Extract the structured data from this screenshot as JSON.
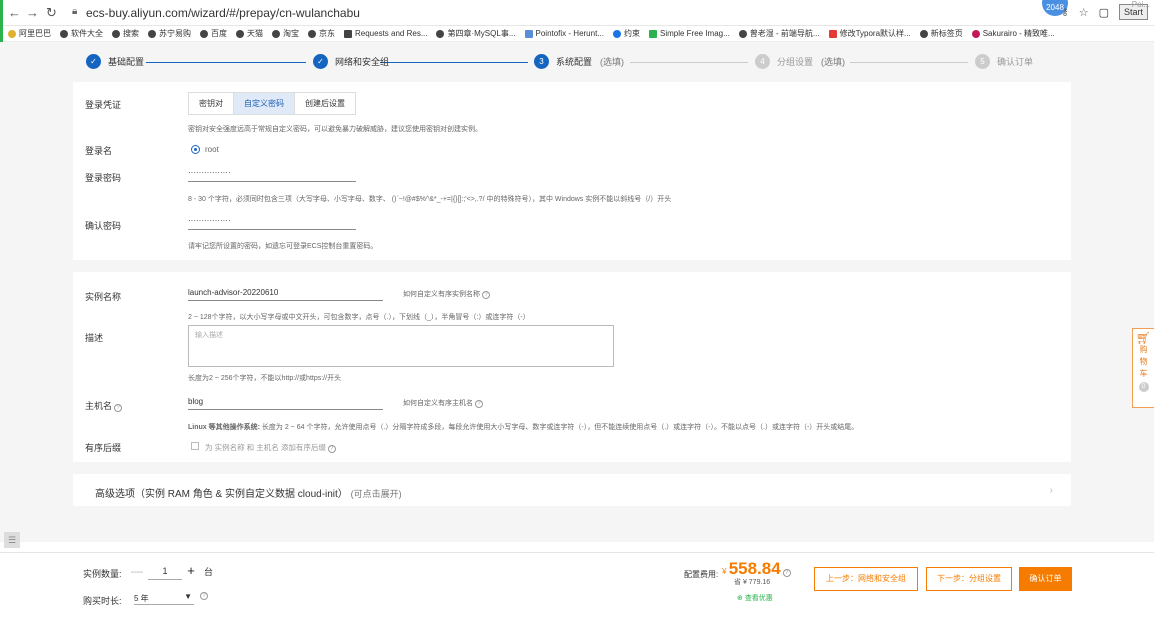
{
  "browser": {
    "url": "ecs-buy.aliyun.com/wizard/#/prepay/cn-wulanchabu",
    "profile_badge": "2048",
    "start_label": "Start",
    "ext_text": "Poi..."
  },
  "bookmarks": [
    "阿里巴巴",
    "软件大全",
    "搜索",
    "苏宁易购",
    "百度",
    "天猫",
    "淘宝",
    "京东",
    "Requests and Res...",
    "第四章·MySQL事...",
    "Pointofix - Herunt...",
    "约束",
    "Simple Free Imag...",
    "曾老湿 - 前端导航...",
    "修改Typora默认样...",
    "新标签页",
    "Sakurairo - 精致唯..."
  ],
  "steps": [
    {
      "num": "✓",
      "label": "基础配置",
      "sub": "",
      "state": "done"
    },
    {
      "num": "✓",
      "label": "网络和安全组",
      "sub": "",
      "state": "done"
    },
    {
      "num": "3",
      "label": "系统配置",
      "sub": "(选填)",
      "state": "active"
    },
    {
      "num": "4",
      "label": "分组设置",
      "sub": "(选填)",
      "state": "todo"
    },
    {
      "num": "5",
      "label": "确认订单",
      "sub": "",
      "state": "todo"
    }
  ],
  "login": {
    "credential_label": "登录凭证",
    "tabs": [
      "密钥对",
      "自定义密码",
      "创建后设置"
    ],
    "active_tab": 1,
    "credential_hint": "密钥对安全强度远高于常规自定义密码，可以避免暴力破解威胁，建议您使用密钥对创建实例。",
    "name_label": "登录名",
    "name_value": "root",
    "password_label": "登录密码",
    "password_value": "················",
    "password_hint": "8 - 30 个字符，必须同时包含三项（大写字母、小写字母、数字、 ()`~!@#$%^&*_-+=|{}[]:;'<>,.?/ 中的特殊符号），其中 Windows 实例不能以斜线号（/）开头",
    "confirm_label": "确认密码",
    "confirm_value": "················",
    "confirm_hint": "请牢记您所设置的密码，如遗忘可登录ECS控制台重置密码。"
  },
  "instance": {
    "name_label": "实例名称",
    "name_value": "launch-advisor-20220610",
    "name_help": "如何自定义有序实例名称",
    "name_hint": "2 ~ 128个字符，以大小写字母或中文开头，可包含数字，点号（.），下划线（_），半角冒号（:）或连字符（-）",
    "desc_label": "描述",
    "desc_placeholder": "输入描述",
    "desc_hint": "长度为2 ~ 256个字符，不能以http://或https://开头",
    "host_label": "主机名",
    "host_value": "blog",
    "host_help": "如何自定义有序主机名",
    "host_hint_bold": "Linux 等其他操作系统:",
    "host_hint": " 长度为 2 ~ 64 个字符，允许使用点号（.）分隔字符成多段，每段允许使用大小写字母、数字或连字符（-），但不能连续使用点号（.）或连字符（-）。不能以点号（.）或连字符（-）开头或结尾。",
    "suffix_label": "有序后缀",
    "suffix_text": "为 实例名称 和 主机名 添加有序后缀"
  },
  "advanced": {
    "title": "高级选项（实例 RAM 角色 & 实例自定义数据 cloud-init）",
    "sub": "(可点击展开)"
  },
  "cart": {
    "label": "购物车",
    "count": "0"
  },
  "bottom": {
    "qty_label": "实例数量:",
    "qty_value": "1",
    "qty_unit": "台",
    "duration_label": "购买时长:",
    "duration_value": "5 年",
    "price_label": "配置费用:",
    "price_symbol": "¥",
    "price_value": "558.84",
    "orig_price": "省 ¥ 779.16",
    "discount_link": "查看优惠",
    "prev_button": "上一步：网络和安全组",
    "next_button": "下一步：分组设置",
    "confirm_button": "确认订单"
  },
  "colors": {
    "accent": "#1565c0",
    "orange": "#f57c00",
    "green": "#2bb24c"
  }
}
